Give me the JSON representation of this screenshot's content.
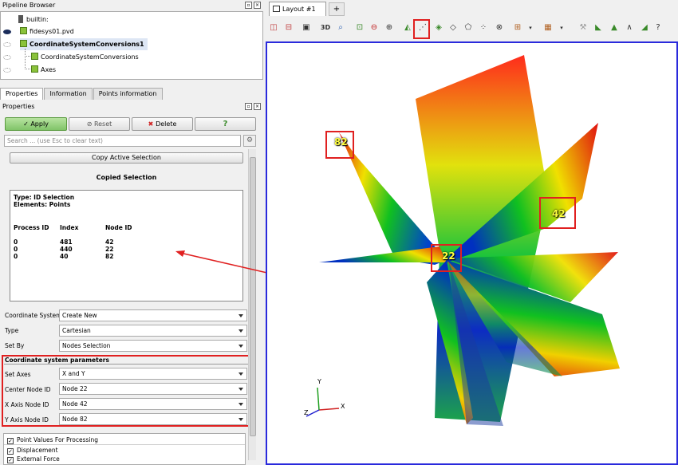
{
  "pipeline": {
    "title": "Pipeline Browser",
    "items": [
      {
        "label": "builtin:"
      },
      {
        "label": "fidesys01.pvd"
      },
      {
        "label": "CoordinateSystemConversions1"
      },
      {
        "label": "CoordinateSystemConversions"
      },
      {
        "label": "Axes"
      }
    ]
  },
  "tabs": [
    "Properties",
    "Information",
    "Points information"
  ],
  "properties": {
    "title": "Properties",
    "apply_label": "Apply",
    "reset_label": "Reset",
    "delete_label": "Delete",
    "help_label": "?",
    "search_placeholder": "Search ... (use Esc to clear text)",
    "copy_button_label": "Copy Active Selection",
    "copied_heading": "Copied Selection",
    "selection": {
      "type_line": "Type: ID Selection",
      "elements_line": "Elements: Points",
      "headers": [
        "Process ID",
        "Index",
        "Node ID"
      ],
      "rows": [
        [
          "0",
          "481",
          "42"
        ],
        [
          "0",
          "440",
          "22"
        ],
        [
          "0",
          "40",
          "82"
        ]
      ]
    },
    "coordinate_system_label": "Coordinate System",
    "coordinate_system_value": "Create New",
    "type_label": "Type",
    "type_value": "Cartesian",
    "set_by_label": "Set By",
    "set_by_value": "Nodes Selection",
    "params_heading": "Coordinate system parameters",
    "set_axes_label": "Set Axes",
    "set_axes_value": "X and Y",
    "center_label": "Center Node ID",
    "center_value": "Node 22",
    "xaxis_label": "X Axis Node ID",
    "xaxis_value": "Node 42",
    "yaxis_label": "Y Axis Node ID",
    "yaxis_value": "Node 82",
    "point_values_heading": "Point Values For Processing",
    "point_values": [
      "Displacement",
      "External Force"
    ]
  },
  "layout": {
    "tab_label": "Layout #1",
    "tab_close": "x",
    "plus_label": "+",
    "view_3d_label": "3D"
  },
  "viewport": {
    "node_labels": [
      "82",
      "42",
      "22"
    ],
    "axis_labels": [
      "Y",
      "X",
      "Z"
    ]
  }
}
